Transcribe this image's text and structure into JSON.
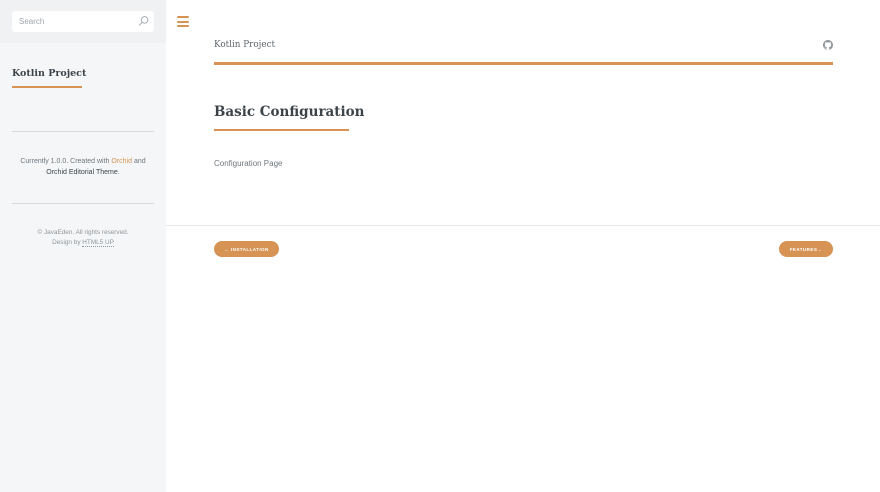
{
  "sidebar": {
    "search": {
      "placeholder": "Search",
      "icon": "search-icon"
    },
    "title": "Kotlin Project",
    "credits": {
      "prefix": "Currently 1.0.0. Created with ",
      "link_orchid": "Orchid",
      "and": " and",
      "theme": "Orchid Editorial Theme",
      "period": "."
    },
    "copyright": {
      "line1": "© JavaEden. All rights reserved.",
      "design_prefix": "Design by ",
      "design_link": "HTML5 UP"
    }
  },
  "header": {
    "menu_icon": "hamburger-menu-icon",
    "title": "Kotlin Project",
    "github_icon": "github-icon"
  },
  "main": {
    "page_title": "Basic Configuration",
    "body_text": "Configuration Page"
  },
  "pagination": {
    "prev_label": "← INSTALLATION",
    "next_label": "FEATURES→"
  },
  "colors": {
    "accent": "#d69354",
    "sidebar_bg": "#f5f6f7",
    "heading": "#3d4449"
  }
}
